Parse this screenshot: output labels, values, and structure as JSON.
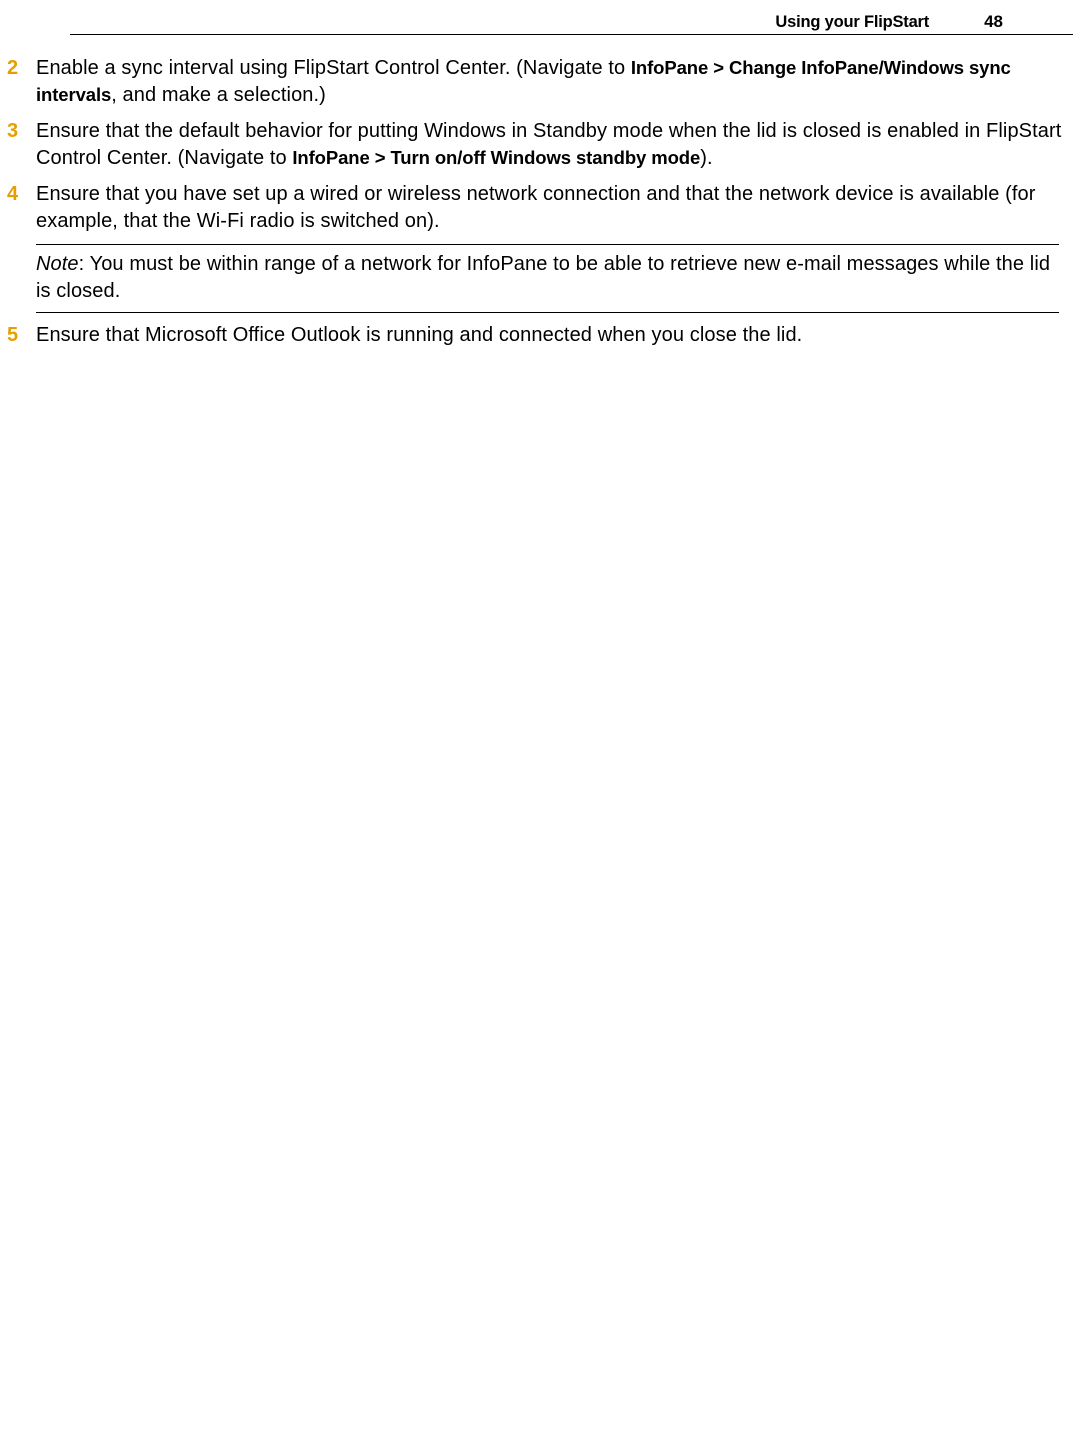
{
  "header": {
    "title": "Using your FlipStart",
    "page_number": "48"
  },
  "items": [
    {
      "num": "2",
      "parts": [
        {
          "t": "Enable a sync interval using FlipStart Control Center. (Navigate to "
        },
        {
          "t": "InfoPane > Change InfoPane/Windows sync intervals",
          "b": true
        },
        {
          "t": ", and make a selection.)"
        }
      ]
    },
    {
      "num": "3",
      "parts": [
        {
          "t": "Ensure that the default behavior for putting Windows in Standby mode when the lid is closed is enabled in FlipStart Control Center. (Navigate to "
        },
        {
          "t": "InfoPane > Turn on/off Windows standby mode",
          "b": true
        },
        {
          "t": ")."
        }
      ]
    },
    {
      "num": "4",
      "parts": [
        {
          "t": "Ensure that you have set up a wired or wireless network connection and that the network device is available (for example, that the Wi-Fi radio is switched on)."
        }
      ]
    }
  ],
  "note": {
    "label": "Note",
    "text": ": You must be within range of a network for InfoPane to be able to retrieve new e-mail messages while the lid is closed."
  },
  "items_after": [
    {
      "num": "5",
      "parts": [
        {
          "t": "Ensure that Microsoft Office Outlook is running and connected when you close the lid."
        }
      ]
    }
  ]
}
